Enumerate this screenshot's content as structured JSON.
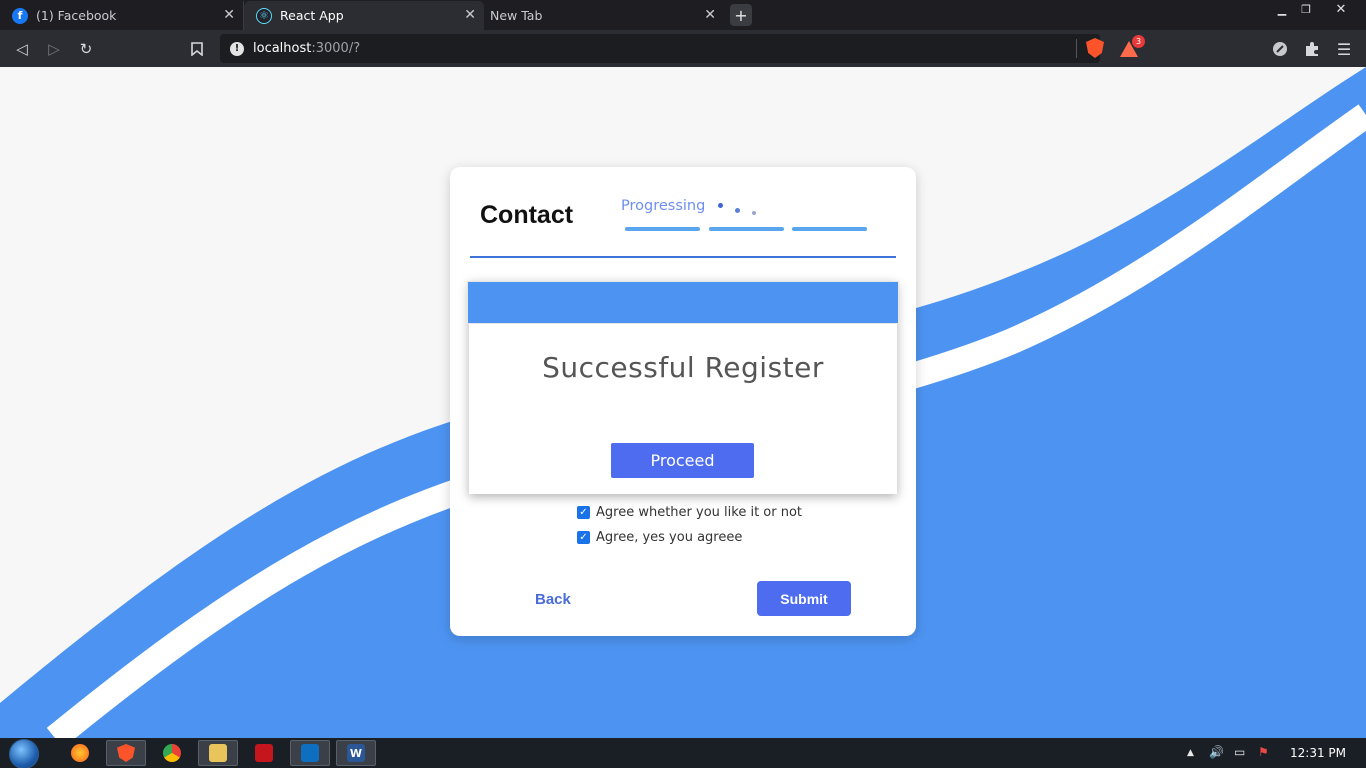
{
  "browser": {
    "tabs": [
      {
        "title": "(1) Facebook",
        "active": false
      },
      {
        "title": "React App",
        "active": true
      },
      {
        "title": "New Tab",
        "active": false
      }
    ],
    "url": {
      "host": "localhost",
      "rest": ":3000/?"
    },
    "rewards_count": "3"
  },
  "card": {
    "title": "Contact",
    "progress_label": "Progressing",
    "checkboxes": [
      {
        "label": "Agree whether you like it or not",
        "checked": true
      },
      {
        "label": "Agree, yes you agreee",
        "checked": true
      }
    ],
    "back_label": "Back",
    "submit_label": "Submit"
  },
  "modal": {
    "title": "Successful Register",
    "proceed_label": "Proceed"
  },
  "taskbar": {
    "clock": "12:31 PM"
  },
  "colors": {
    "accent": "#4d6cf0",
    "wave_blue": "#4d94f2",
    "divider": "#3f73d8",
    "step_bar": "#5aa6ee"
  }
}
